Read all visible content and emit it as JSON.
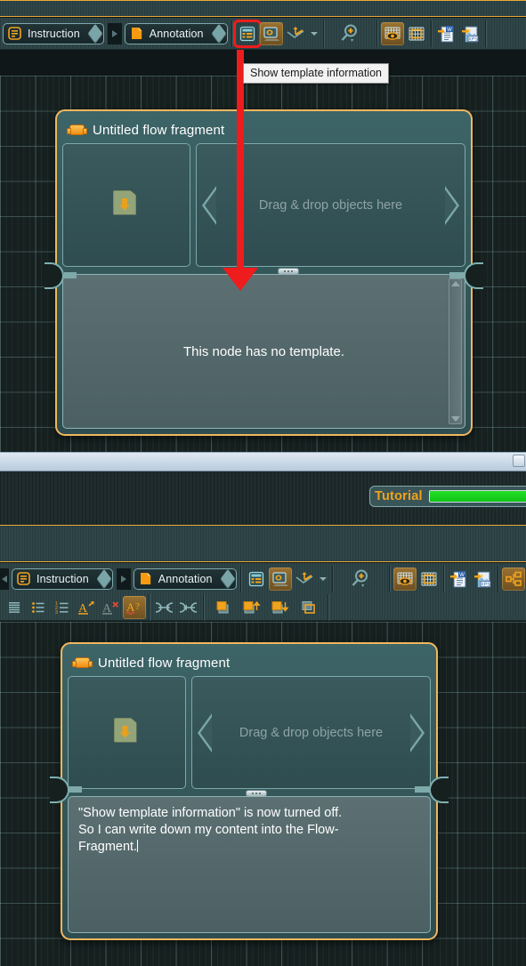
{
  "app": {
    "tooltip": "Show template information"
  },
  "toolbar_top": {
    "tabs": [
      {
        "label": "Instruction",
        "icon": "instruction-icon"
      },
      {
        "label": "Annotation",
        "icon": "annotation-icon"
      }
    ],
    "buttons": [
      {
        "name": "show-template-information",
        "icon": "template-info-icon",
        "state": "highlighted"
      },
      {
        "name": "show-node-preview",
        "icon": "node-preview-icon",
        "state": "active"
      },
      {
        "name": "show-transitions",
        "icon": "transition-curve-icon",
        "state": "normal"
      },
      {
        "name": "transitions-dropdown",
        "icon": "chevron-down-icon",
        "state": "normal"
      },
      {
        "name": "zoom",
        "icon": "zoom-in-icon",
        "state": "normal"
      },
      {
        "name": "show-grid-preview",
        "icon": "grid-eye-icon",
        "state": "active"
      },
      {
        "name": "snap-to-grid",
        "icon": "grid-icon",
        "state": "normal"
      },
      {
        "name": "export-word",
        "icon": "word-export-icon",
        "state": "normal"
      },
      {
        "name": "export-xps",
        "icon": "xps-export-icon",
        "state": "normal"
      }
    ]
  },
  "toolbar_bottom": {
    "tabs": [
      {
        "label": "Instruction",
        "icon": "instruction-icon"
      },
      {
        "label": "Annotation",
        "icon": "annotation-icon"
      }
    ],
    "buttons": [
      {
        "name": "show-template-information",
        "icon": "template-info-icon",
        "state": "normal"
      },
      {
        "name": "show-node-preview",
        "icon": "node-preview-icon",
        "state": "active"
      },
      {
        "name": "show-transitions",
        "icon": "transition-curve-icon",
        "state": "normal"
      },
      {
        "name": "transitions-dropdown",
        "icon": "chevron-down-icon",
        "state": "normal"
      },
      {
        "name": "zoom",
        "icon": "zoom-in-icon",
        "state": "normal"
      },
      {
        "name": "show-grid-preview",
        "icon": "grid-eye-icon",
        "state": "active"
      },
      {
        "name": "snap-to-grid",
        "icon": "grid-icon",
        "state": "normal"
      },
      {
        "name": "export-word",
        "icon": "word-export-icon",
        "state": "normal"
      },
      {
        "name": "export-xps",
        "icon": "xps-export-icon",
        "state": "normal"
      },
      {
        "name": "flow-view",
        "icon": "flow-graph-icon",
        "state": "active"
      },
      {
        "name": "table-view",
        "icon": "table-grid-icon",
        "state": "normal"
      }
    ],
    "format_buttons": [
      {
        "name": "paragraph",
        "icon": "paragraph-lines-icon"
      },
      {
        "name": "bullet-list",
        "icon": "bullet-list-icon"
      },
      {
        "name": "numbered-list",
        "icon": "numbered-list-icon"
      },
      {
        "name": "increase-font-size",
        "icon": "font-grow-icon"
      },
      {
        "name": "clear-formatting",
        "icon": "font-clear-icon"
      },
      {
        "name": "spell-check",
        "icon": "spellcheck-icon"
      },
      {
        "name": "indent-in",
        "icon": "indent-in-icon"
      },
      {
        "name": "indent-out",
        "icon": "indent-out-icon"
      },
      {
        "name": "bring-to-front",
        "icon": "layer-front-icon"
      },
      {
        "name": "bring-forward",
        "icon": "layer-forward-icon"
      },
      {
        "name": "send-backward",
        "icon": "layer-backward-icon"
      },
      {
        "name": "send-to-back",
        "icon": "layer-back-icon"
      }
    ]
  },
  "node_top": {
    "title": "Untitled flow fragment",
    "drop_hint": "Drag & drop objects here",
    "body_text": "This node has no template."
  },
  "node_bottom": {
    "title": "Untitled flow fragment",
    "drop_hint": "Drag & drop objects here",
    "body_text": "\"Show template information\" is now turned off.\nSo I can write down my content into the Flow-\nFragment."
  },
  "tutorial": {
    "label": "Tutorial",
    "progress_percent": 100
  },
  "colors": {
    "accent_orange": "#f0a31e",
    "node_border": "#f0b75e",
    "panel_border": "#e8a93a",
    "annotation_red": "#ee1c1c",
    "progress_green": "#19cf1d"
  }
}
